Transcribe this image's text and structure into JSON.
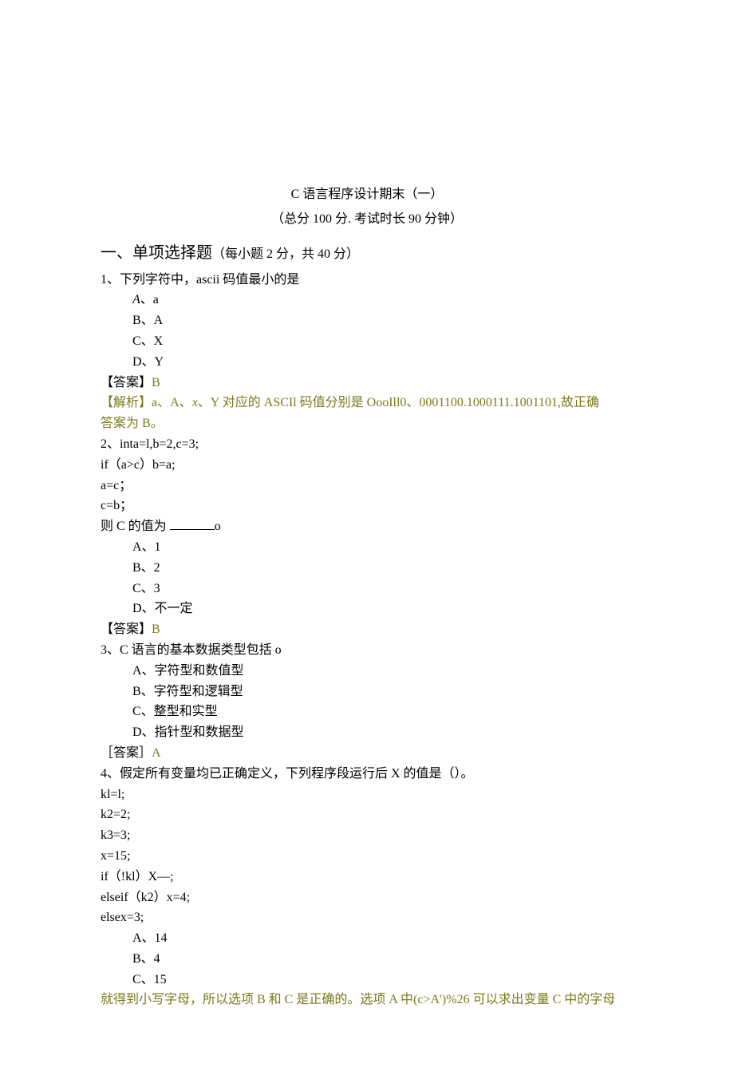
{
  "header": {
    "title": "C 语言程序设计期末（一）",
    "subtitle": "（总分 100 分. 考试时长 90 分钟）"
  },
  "section1": {
    "heading_main": "一、单项选择题",
    "heading_sub": "（每小题 2 分，共 40 分）"
  },
  "q1": {
    "stem": "1、下列字符中，ascii 码值最小的是",
    "optA_label": "A",
    "optA_text": "、a",
    "optB": "B、A",
    "optC": "C、X",
    "optD": "D、Y",
    "ans_label": "【答案】",
    "ans_val": "B",
    "exp_label": "【解析】",
    "exp_a": "a、A、",
    "exp_x": "x",
    "exp_rest1": "、Y 对应的 ASCIl 码值分别是 OooIll0、0001100.1000111.1001101,故正确",
    "exp_line2": "答案为 B。"
  },
  "q2": {
    "l1": "2、inta=l,b=2,c=3;",
    "l1_sub": "t",
    "l2": "if（a>c）b=a;",
    "l3": "a=c；",
    "l4": "c=b；",
    "l5a": "则 C 的值为 ",
    "l5b": "o",
    "optA": "A、1",
    "optB": "B、2",
    "optC": "C、3",
    "optD": "D、不一定",
    "ans_label": "【答案】",
    "ans_val": "B"
  },
  "q3": {
    "stem": "3、C 语言的基本数据类型包括 o",
    "optA": "A、字符型和数值型",
    "optB": "B、字符型和逻辑型",
    "optC": "C、整型和实型",
    "optD": "D、指针型和数据型",
    "ans_label": "［答案］",
    "ans_val": "A"
  },
  "q4": {
    "stem": "4、假定所有变量均已正确定义，下列程序段运行后 X 的值是（）。",
    "l1": "kl=l;",
    "l2": "k2=2;",
    "l3": "k3=3;",
    "l4": "x=15;",
    "l5": "if（!kl）X—;",
    "l6": "elseif（k2）x=4;",
    "l7": "elsex=3;",
    "optA": "A、14",
    "optB": "B、4",
    "optC": "C、15"
  },
  "footer": {
    "text": "就得到小写字母，所以选项 B 和 C 是正确的。选项 A 中(c>A')%26 可以求出变量 C 中的字母"
  }
}
